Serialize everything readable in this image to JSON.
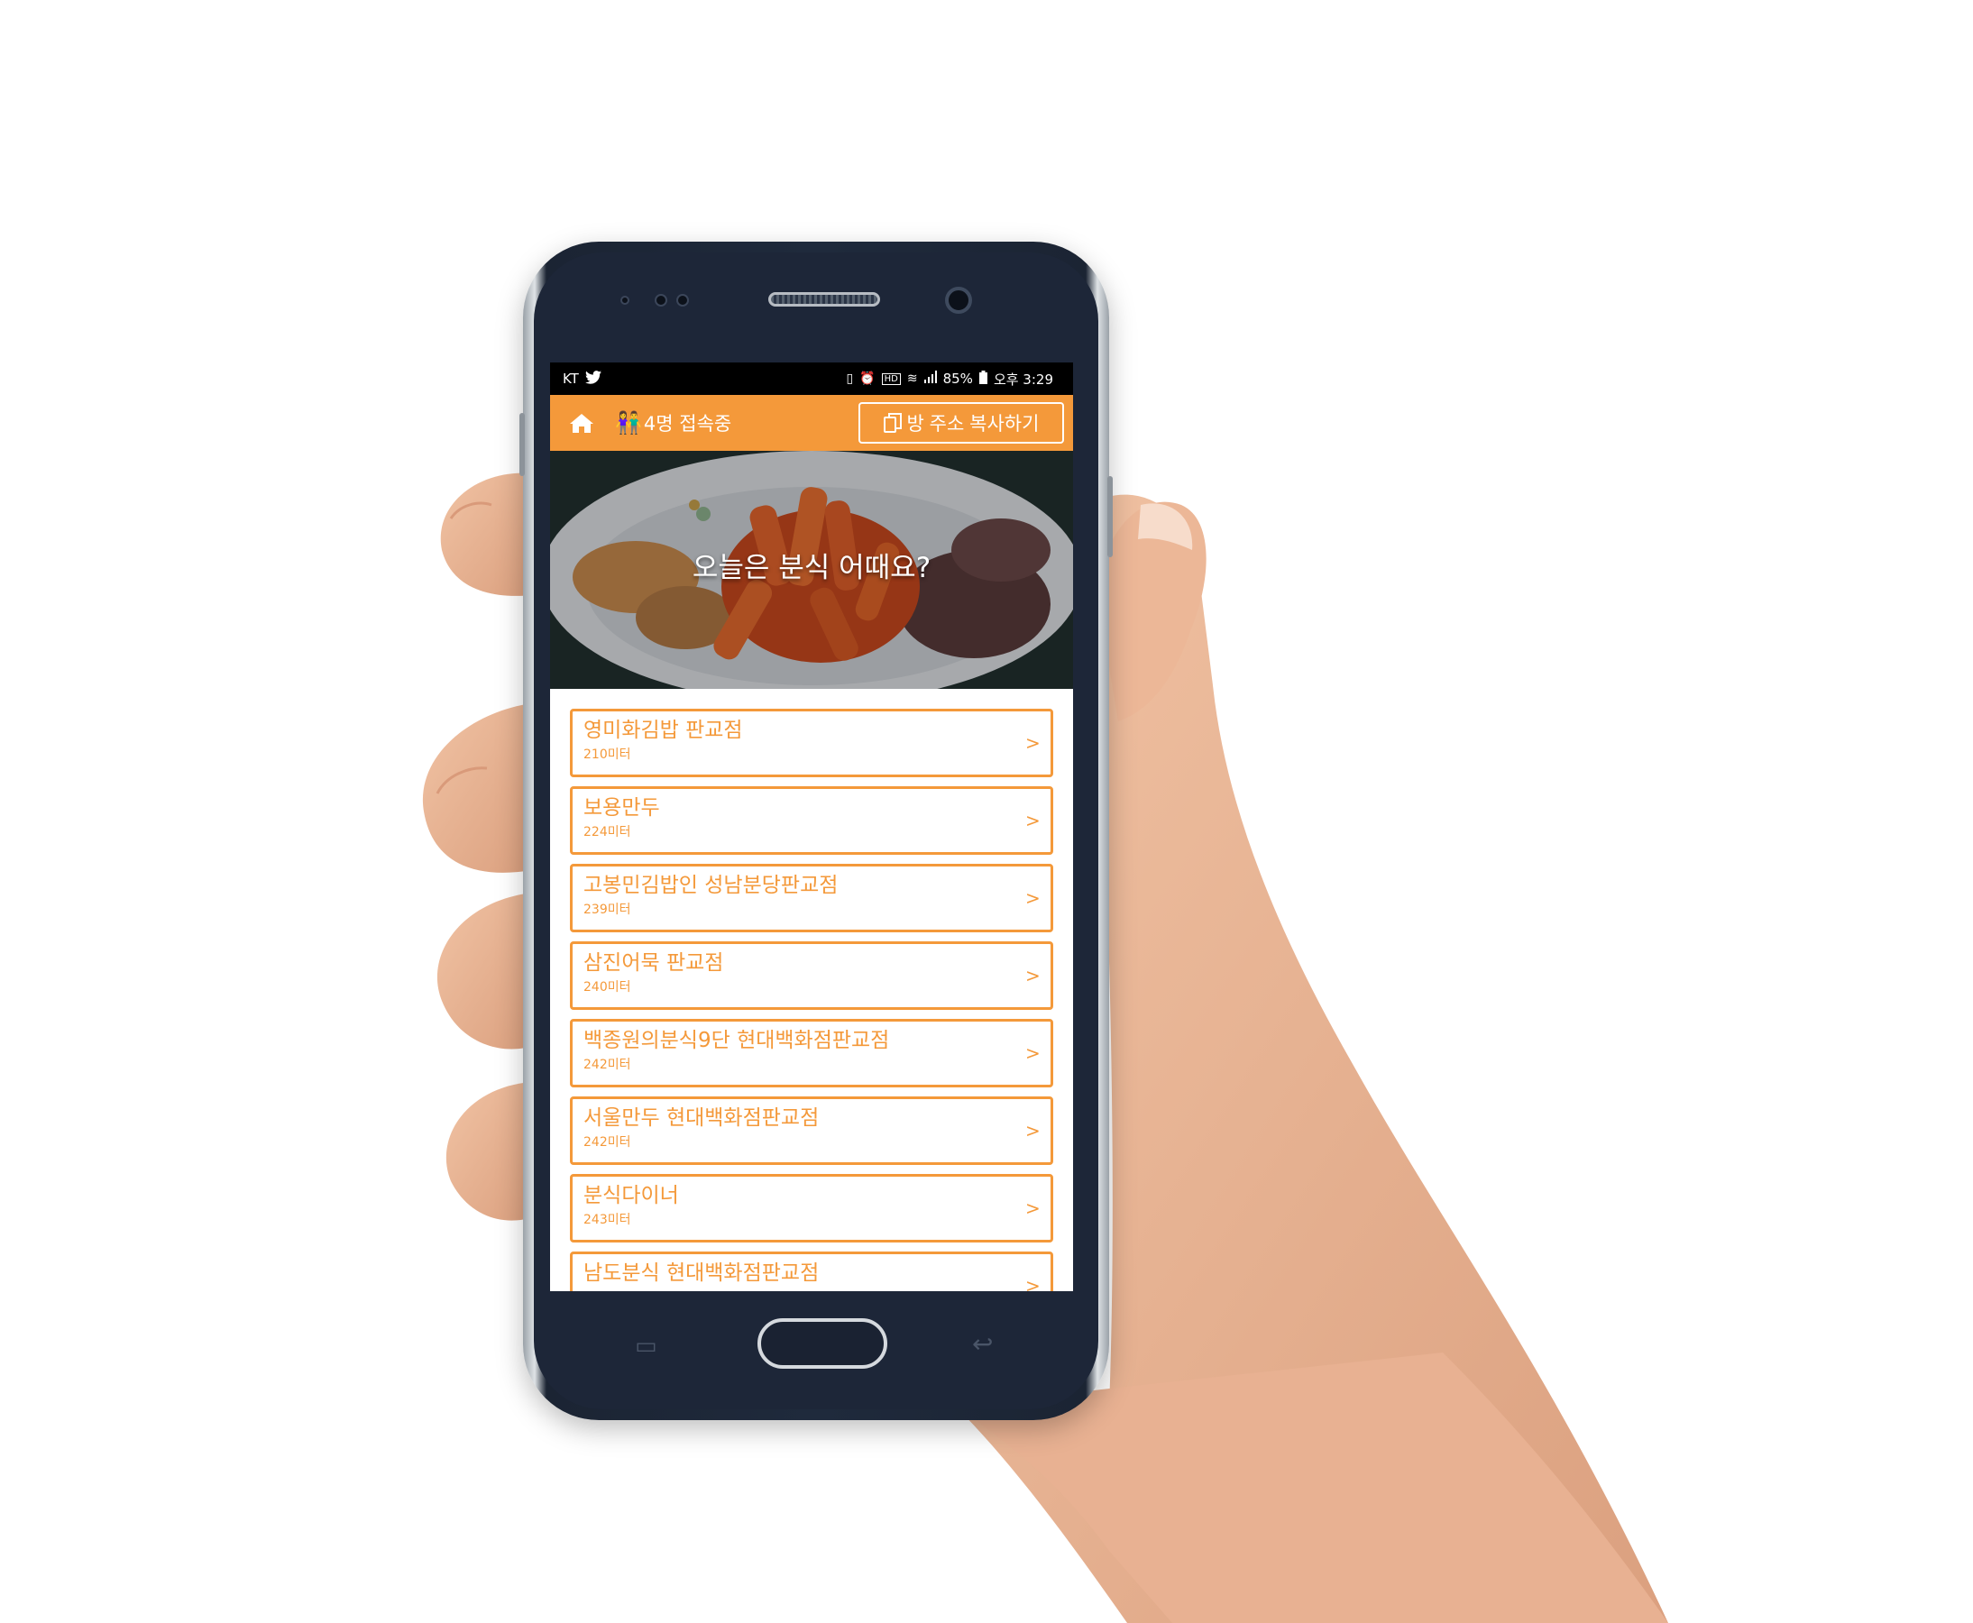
{
  "status_bar": {
    "carrier": "KT",
    "battery": "85%",
    "time": "오후 3:29",
    "icons": [
      "twitter-icon",
      "vibrate-icon",
      "alarm-icon",
      "hd-icon",
      "wifi-icon",
      "signal-icon",
      "battery-icon"
    ]
  },
  "app_bar": {
    "online_count": "4명 접속중",
    "copy_label": "방 주소 복사하기",
    "color": "#f4993a"
  },
  "banner": {
    "title": "오늘은 분식 어때요?"
  },
  "restaurants": [
    {
      "name": "영미화김밥 판교점",
      "distance": "210미터"
    },
    {
      "name": "보용만두",
      "distance": "224미터"
    },
    {
      "name": "고봉민김밥인 성남분당판교점",
      "distance": "239미터"
    },
    {
      "name": "삼진어묵 판교점",
      "distance": "240미터"
    },
    {
      "name": "백종원의분식9단 현대백화점판교점",
      "distance": "242미터"
    },
    {
      "name": "서울만두 현대백화점판교점",
      "distance": "242미터"
    },
    {
      "name": "분식다이너",
      "distance": "243미터"
    },
    {
      "name": "남도분식 현대백화점판교점",
      "distance": ""
    }
  ]
}
